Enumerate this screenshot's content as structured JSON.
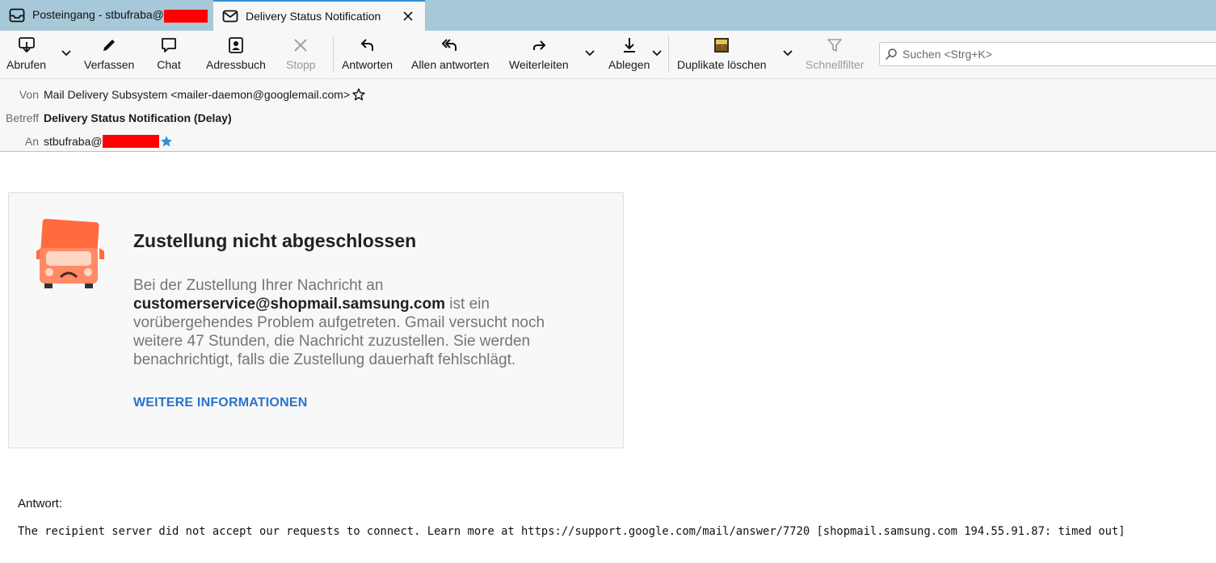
{
  "tabs": [
    {
      "label": "Posteingang - stbufraba@",
      "icon": "inbox-icon"
    },
    {
      "label": "Delivery Status Notification",
      "icon": "envelope-icon"
    }
  ],
  "toolbar": {
    "get_messages": "Abrufen",
    "compose": "Verfassen",
    "chat": "Chat",
    "address_book": "Adressbuch",
    "stop": "Stopp",
    "reply": "Antworten",
    "reply_all": "Allen antworten",
    "forward": "Weiterleiten",
    "archive": "Ablegen",
    "remove_duplicates": "Duplikate löschen",
    "quick_filter": "Schnellfilter",
    "search_placeholder": "Suchen <Strg+K>"
  },
  "header": {
    "from_label": "Von",
    "from_value": "Mail Delivery Subsystem <mailer-daemon@googlemail.com>",
    "subject_label": "Betreff",
    "subject_value": "Delivery Status Notification (Delay)",
    "to_label": "An",
    "to_value": "stbufraba@"
  },
  "message": {
    "title": "Zustellung nicht abgeschlossen",
    "text_before": "Bei der Zustellung Ihrer Nachricht an ",
    "recipient": "customerservice@shopmail.samsung.com",
    "text_after": " ist ein vorübergehendes Problem aufgetreten. Gmail versucht noch weitere 47 Stunden, die Nachricht zuzustellen. Sie werden benachrichtigt, falls die Zustellung dauerhaft fehlschlägt.",
    "link": "WEITERE INFORMATIONEN",
    "reply_label": "Antwort:",
    "reply_text": "The recipient server did not accept our requests to connect. Learn more at https://support.google.com/mail/answer/7720 [shopmail.samsung.com 194.55.91.87: timed out]"
  },
  "colors": {
    "tabbar": "#a7c8d8",
    "link": "#2a73cc",
    "truck": "#ff7043",
    "redaction": "#ff0000",
    "star_blue": "#2f8fd8"
  }
}
